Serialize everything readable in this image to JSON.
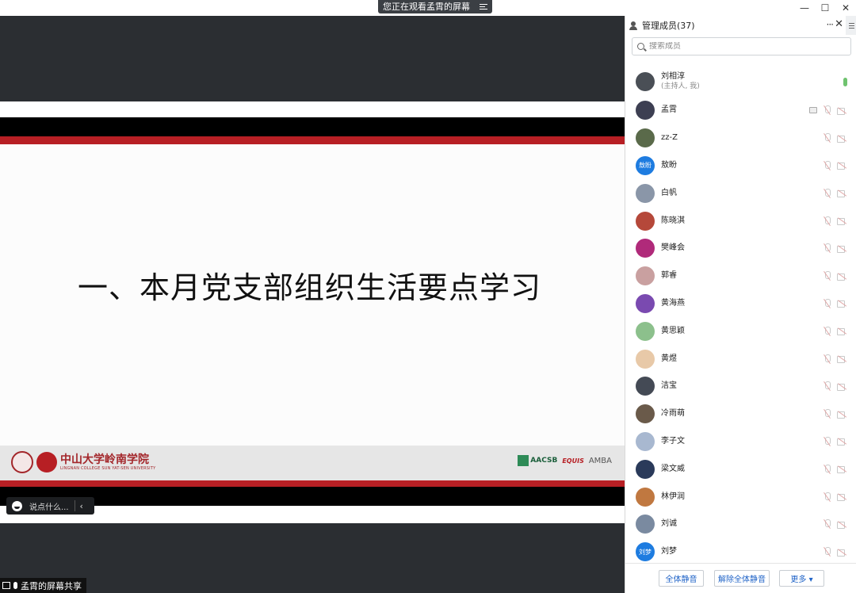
{
  "banner": {
    "text": "您正在观看孟霄的屏幕",
    "list_icon": "list-icon"
  },
  "window": {
    "minimize": "—",
    "maximize": "☐",
    "close": "✕"
  },
  "slide": {
    "title": "一、本月党支部组织生活要点学习",
    "college_cn": "中山大学岭南学院",
    "college_en": "LINGNAN COLLEGE SUN YAT-SEN UNIVERSITY",
    "accreditations": [
      "AACSB",
      "EQUIS",
      "AMBA"
    ]
  },
  "chat": {
    "placeholder": "说点什么...",
    "arrow": "‹"
  },
  "status": {
    "text": "孟霄的屏幕共享"
  },
  "panel": {
    "title": "管理成员(37)",
    "dots": "···",
    "close": "✕",
    "search_placeholder": "搜索成员",
    "members": [
      {
        "name": "刘相淳",
        "sub": "(主持人, 我)",
        "avatar_color": "#4a4f56",
        "state": "mic-on"
      },
      {
        "name": "孟霄",
        "sub": "",
        "avatar_color": "#3d3f52",
        "state": "sharing"
      },
      {
        "name": "zz-Z",
        "sub": "",
        "avatar_color": "#5a6a4a",
        "state": "muted"
      },
      {
        "name": "敖盼",
        "sub": "",
        "avatar_color": "#1e7ce0",
        "avatar_text": "敖盼",
        "state": "muted"
      },
      {
        "name": "白帆",
        "sub": "",
        "avatar_color": "#8a96a8",
        "state": "muted"
      },
      {
        "name": "陈晓淇",
        "sub": "",
        "avatar_color": "#b5483a",
        "state": "muted"
      },
      {
        "name": "樊峰会",
        "sub": "",
        "avatar_color": "#b02a7a",
        "state": "muted"
      },
      {
        "name": "郭睿",
        "sub": "",
        "avatar_color": "#c9a0a0",
        "state": "muted"
      },
      {
        "name": "黄海燕",
        "sub": "",
        "avatar_color": "#7a4ab0",
        "state": "muted"
      },
      {
        "name": "黄思颖",
        "sub": "",
        "avatar_color": "#8cc08c",
        "state": "muted"
      },
      {
        "name": "黄煜",
        "sub": "",
        "avatar_color": "#e8c9a8",
        "state": "muted"
      },
      {
        "name": "洁宝",
        "sub": "",
        "avatar_color": "#444a55",
        "state": "muted"
      },
      {
        "name": "冷雨萌",
        "sub": "",
        "avatar_color": "#6a5a4a",
        "state": "muted"
      },
      {
        "name": "李子文",
        "sub": "",
        "avatar_color": "#a8b8d0",
        "state": "muted"
      },
      {
        "name": "梁文威",
        "sub": "",
        "avatar_color": "#2a3a5a",
        "state": "muted"
      },
      {
        "name": "林伊润",
        "sub": "",
        "avatar_color": "#c07840",
        "state": "muted"
      },
      {
        "name": "刘诚",
        "sub": "",
        "avatar_color": "#7a8aa0",
        "state": "muted"
      },
      {
        "name": "刘梦",
        "sub": "",
        "avatar_color": "#1e7ce0",
        "avatar_text": "刘梦",
        "state": "muted"
      }
    ],
    "footer": {
      "mute_all": "全体静音",
      "unmute_all": "解除全体静音",
      "more": "更多 ▾"
    }
  }
}
